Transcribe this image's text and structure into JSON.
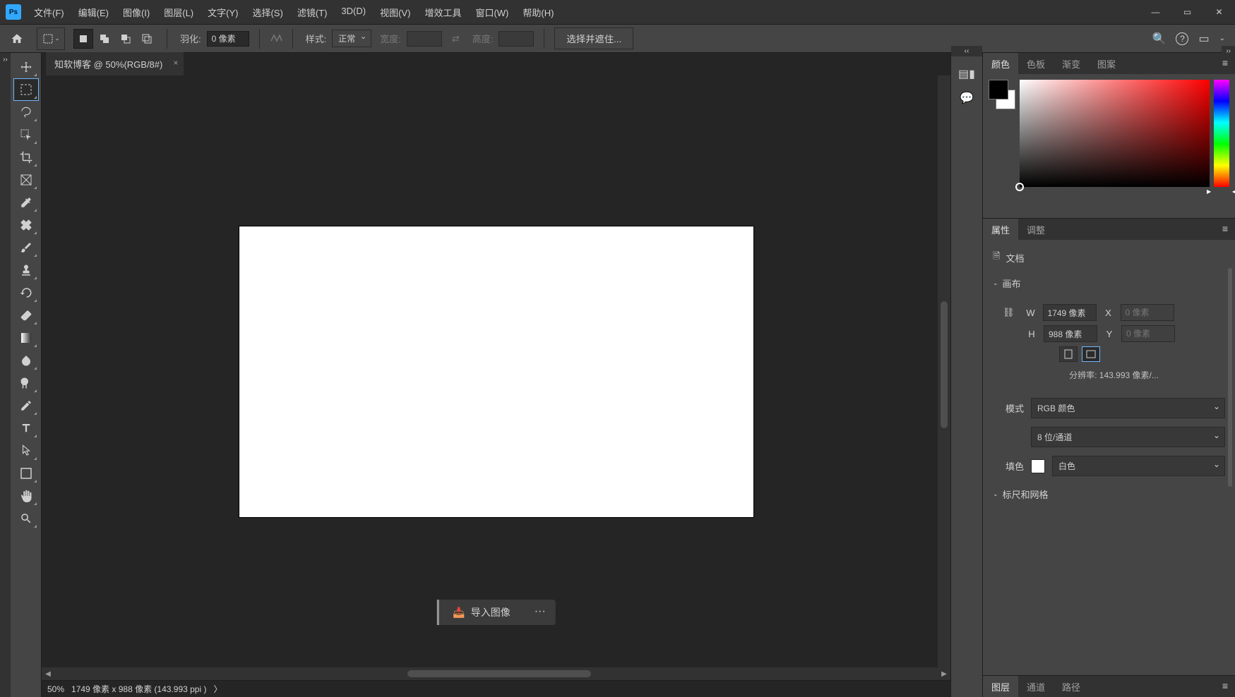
{
  "app": {
    "logo": "Ps"
  },
  "menus": [
    "文件(F)",
    "编辑(E)",
    "图像(I)",
    "图层(L)",
    "文字(Y)",
    "选择(S)",
    "滤镜(T)",
    "3D(D)",
    "视图(V)",
    "增效工具",
    "窗口(W)",
    "帮助(H)"
  ],
  "tab": {
    "title": "知软博客 @ 50%(RGB/8#)",
    "close": "×"
  },
  "options": {
    "feather_label": "羽化:",
    "feather_value": "0 像素",
    "style_label": "样式:",
    "style_value": "正常",
    "width_label": "宽度:",
    "height_label": "高度:",
    "mask_btn": "选择并遮住..."
  },
  "import_btn": "导入图像",
  "status": {
    "zoom": "50%",
    "info": "1749 像素 x 988 像素 (143.993 ppi )",
    "arrow": "〉"
  },
  "panels": {
    "color_tabs": [
      "颜色",
      "色板",
      "渐变",
      "图案"
    ],
    "props_tabs": [
      "属性",
      "调整"
    ],
    "layers_tabs": [
      "图层",
      "通道",
      "路径"
    ]
  },
  "props": {
    "doc_heading": "文档",
    "canvas_section": "画布",
    "w_label": "W",
    "w_val": "1749 像素",
    "h_label": "H",
    "h_val": "988 像素",
    "x_label": "X",
    "x_val": "0 像素",
    "y_label": "Y",
    "y_val": "0 像素",
    "resolution": "分辨率: 143.993 像素/...",
    "mode_label": "模式",
    "mode_val": "RGB 颜色",
    "depth_val": "8 位/通道",
    "fill_label": "填色",
    "fill_val": "白色",
    "rulers_section": "标尺和网格"
  }
}
